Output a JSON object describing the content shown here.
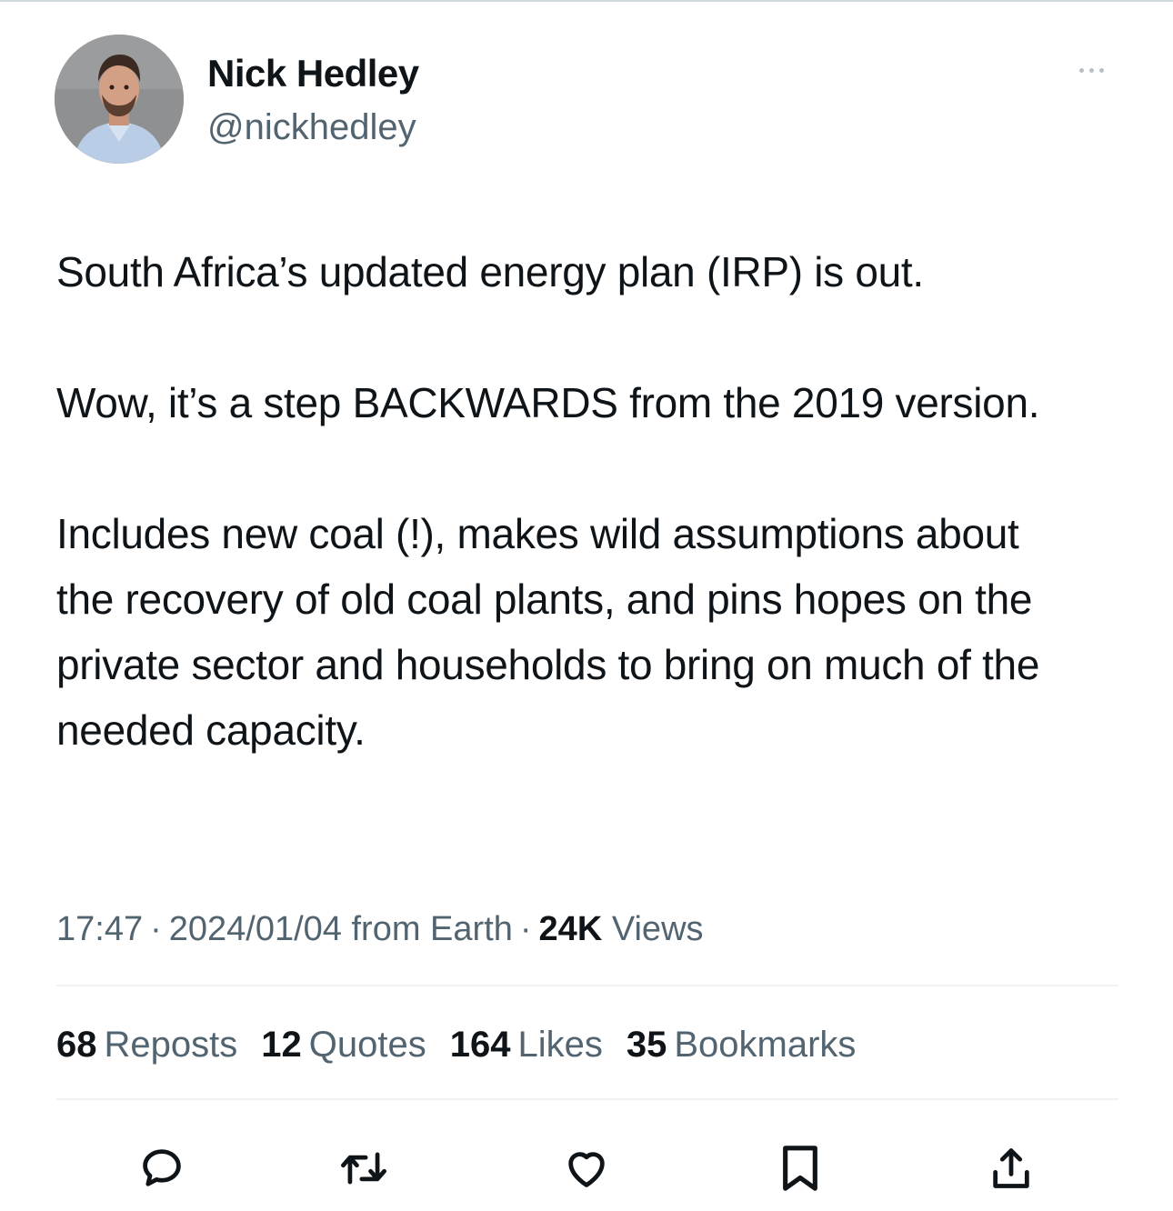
{
  "author": {
    "display_name": "Nick Hedley",
    "handle": "@nickhedley",
    "avatar_icon": "avatar-photo"
  },
  "tweet": {
    "paragraphs": [
      "South Africa’s updated energy plan (IRP) is out.",
      "Wow, it’s a step BACKWARDS from the 2019 version.",
      "Includes new coal (!), makes wild assumptions about the recovery of old coal plants, and pins hopes on the private sector and households to bring on much of the needed capacity."
    ]
  },
  "meta": {
    "time": "17:47",
    "date": "2024/01/04",
    "source": "from Earth",
    "separator": "·",
    "views_count": "24K",
    "views_label": "Views"
  },
  "stats": {
    "reposts": {
      "count": "68",
      "label": "Reposts"
    },
    "quotes": {
      "count": "12",
      "label": "Quotes"
    },
    "likes": {
      "count": "164",
      "label": "Likes"
    },
    "bookmarks": {
      "count": "35",
      "label": "Bookmarks"
    }
  },
  "actions": {
    "reply_icon": "reply-icon",
    "repost_icon": "repost-icon",
    "like_icon": "heart-icon",
    "bookmark_icon": "bookmark-icon",
    "share_icon": "share-icon"
  },
  "colors": {
    "text_primary": "#0f1419",
    "text_secondary": "#536471",
    "divider": "#eff3f4"
  }
}
